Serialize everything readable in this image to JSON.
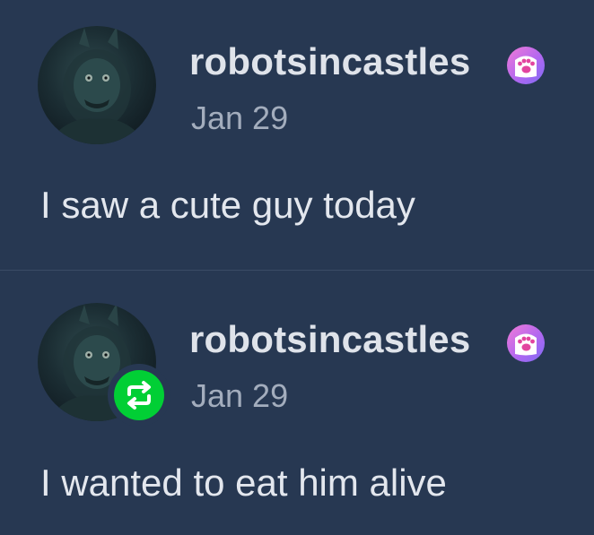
{
  "posts": [
    {
      "username": "robotsincastles",
      "date": "Jan 29",
      "text": "I saw a cute guy today",
      "avatar_icon": "animatronic-avatar",
      "badge_icon": "paw-icon"
    },
    {
      "username": "robotsincastles",
      "date": "Jan 29",
      "text": "I wanted to eat him alive",
      "avatar_icon": "animatronic-avatar",
      "badge_icon": "paw-icon",
      "reblog_icon": "reblog-icon"
    }
  ],
  "colors": {
    "background": "#273852",
    "username": "#dfe3ea",
    "date": "#a3adbd",
    "reblog_green": "#01cf35",
    "badge_pink": "#f27bd6",
    "badge_purple": "#7f6cf5"
  }
}
